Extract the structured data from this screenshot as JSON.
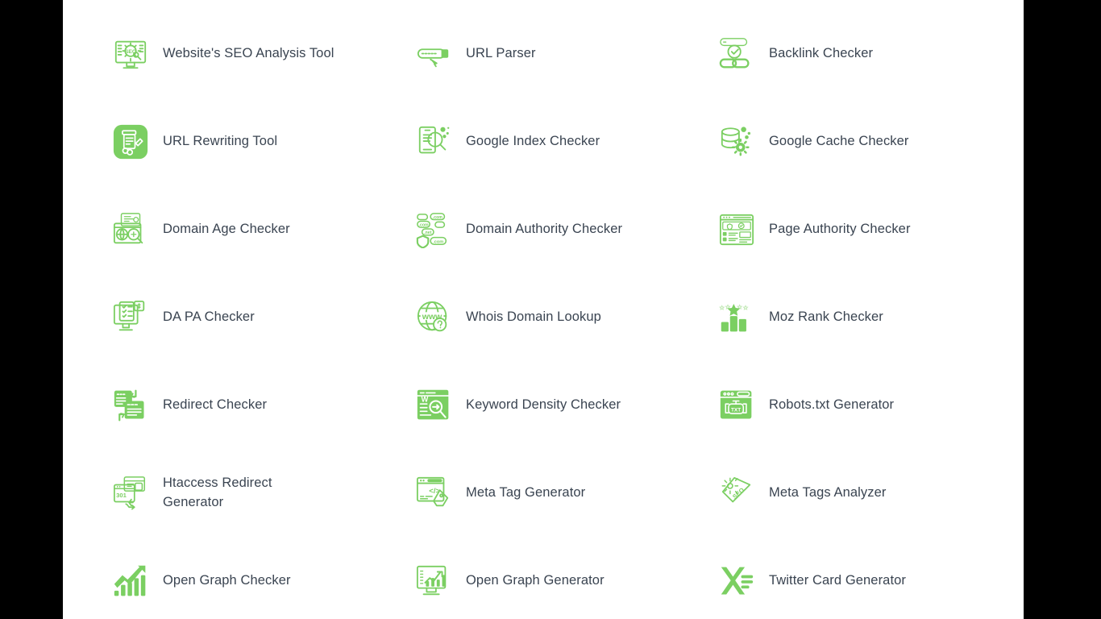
{
  "page": {
    "background_color": "#000000",
    "content_background_color": "#ffffff",
    "accent_color": "#7bcf62",
    "text_color": "#3a4451",
    "columns": 3,
    "rows": 7
  },
  "tools": [
    {
      "label": "Website's SEO Analysis Tool",
      "icon": "seo-monitor-gear-icon",
      "style": "outline"
    },
    {
      "label": "URL Parser",
      "icon": "url-bar-arrow-icon",
      "style": "outline"
    },
    {
      "label": "Backlink Checker",
      "icon": "link-chain-check-icon",
      "style": "outline"
    },
    {
      "label": "URL Rewriting Tool",
      "icon": "document-pencil-link-icon",
      "style": "filled"
    },
    {
      "label": "Google Index Checker",
      "icon": "document-magnifier-icon",
      "style": "outline"
    },
    {
      "label": "Google Cache Checker",
      "icon": "database-gear-icon",
      "style": "outline"
    },
    {
      "label": "Domain Age Checker",
      "icon": "browser-globe-magnifier-icon",
      "style": "outline"
    },
    {
      "label": "Domain Authority Checker",
      "icon": "domain-tags-shield-icon",
      "style": "outline"
    },
    {
      "label": "Page Authority Checker",
      "icon": "browser-page-badge-icon",
      "style": "outline"
    },
    {
      "label": "DA PA Checker",
      "icon": "monitor-checklist-icon",
      "style": "outline"
    },
    {
      "label": "Whois Domain Lookup",
      "icon": "www-globe-question-icon",
      "style": "outline"
    },
    {
      "label": "Moz Rank Checker",
      "icon": "bar-chart-star-icon",
      "style": "filled"
    },
    {
      "label": "Redirect Checker",
      "icon": "two-windows-arrows-icon",
      "style": "filled"
    },
    {
      "label": "Keyword Density Checker",
      "icon": "document-keyword-magnifier-icon",
      "style": "filled"
    },
    {
      "label": "Robots.txt Generator",
      "icon": "browser-robot-txt-icon",
      "style": "filled"
    },
    {
      "label": "Htaccess Redirect Generator",
      "icon": "windows-301-shuffle-icon",
      "style": "outline"
    },
    {
      "label": "Meta Tag Generator",
      "icon": "browser-code-tag-icon",
      "style": "outline"
    },
    {
      "label": "Meta Tags Analyzer",
      "icon": "seo-price-tag-gear-icon",
      "style": "outline"
    },
    {
      "label": "Open Graph Checker",
      "icon": "growth-arrow-bars-icon",
      "style": "filled"
    },
    {
      "label": "Open Graph Generator",
      "icon": "monitor-growth-chart-icon",
      "style": "outline"
    },
    {
      "label": "Twitter Card Generator",
      "icon": "x-twitter-card-icon",
      "style": "filled"
    }
  ]
}
